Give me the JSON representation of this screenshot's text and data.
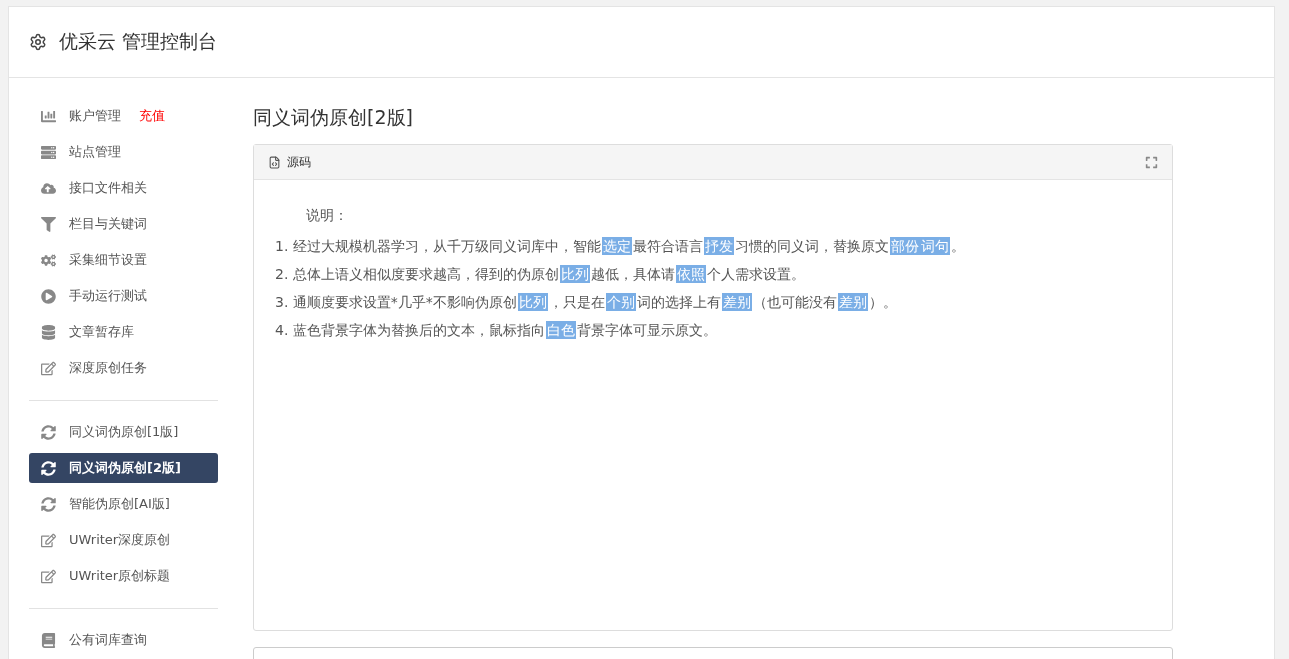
{
  "header": {
    "title": "优采云 管理控制台"
  },
  "sidebar": {
    "groups": [
      {
        "items": [
          {
            "label": "账户管理",
            "badge": "充值",
            "selected": false
          },
          {
            "label": "站点管理",
            "selected": false
          },
          {
            "label": "接口文件相关",
            "selected": false
          },
          {
            "label": "栏目与关键词",
            "selected": false
          },
          {
            "label": "采集细节设置",
            "selected": false
          },
          {
            "label": "手动运行测试",
            "selected": false
          },
          {
            "label": "文章暂存库",
            "selected": false
          },
          {
            "label": "深度原创任务",
            "selected": false
          }
        ]
      },
      {
        "items": [
          {
            "label": "同义词伪原创[1版]",
            "selected": false
          },
          {
            "label": "同义词伪原创[2版]",
            "selected": true
          },
          {
            "label": "智能伪原创[AI版]",
            "selected": false
          },
          {
            "label": "UWriter深度原创",
            "selected": false
          },
          {
            "label": "UWriter原创标题",
            "selected": false
          }
        ]
      },
      {
        "items": [
          {
            "label": "公有词库查询",
            "selected": false
          }
        ]
      }
    ]
  },
  "page_title": "同义词伪原创[2版]",
  "panel": {
    "tab": "源码",
    "heading": "说明：",
    "lines": [
      [
        {
          "text": "1. 经过大规模机器学习，从千万级同义词库中，智能",
          "highlight": false
        },
        {
          "text": "选定",
          "highlight": true
        },
        {
          "text": "最符合语言",
          "highlight": false
        },
        {
          "text": "抒发",
          "highlight": true
        },
        {
          "text": "习惯的同义词，替换原文",
          "highlight": false
        },
        {
          "text": "部份",
          "highlight": true
        },
        {
          "text": "词句",
          "highlight": true
        },
        {
          "text": "。",
          "highlight": false
        }
      ],
      [
        {
          "text": "2. 总体上语义相似度要求越高，得到的伪原创",
          "highlight": false
        },
        {
          "text": "比列",
          "highlight": true
        },
        {
          "text": "越低，具体请",
          "highlight": false
        },
        {
          "text": "依照",
          "highlight": true
        },
        {
          "text": "个人需求设置。",
          "highlight": false
        }
      ],
      [
        {
          "text": "3. 通顺度要求设置*几乎*不影响伪原创",
          "highlight": false
        },
        {
          "text": "比列",
          "highlight": true
        },
        {
          "text": "，只是在",
          "highlight": false
        },
        {
          "text": "个别",
          "highlight": true
        },
        {
          "text": "词的选择上有",
          "highlight": false
        },
        {
          "text": "差别",
          "highlight": true
        },
        {
          "text": "（也可能没有",
          "highlight": false
        },
        {
          "text": "差别",
          "highlight": true
        },
        {
          "text": "）。",
          "highlight": false
        }
      ],
      [
        {
          "text": "4. 蓝色背景字体为替换后的文本，鼠标指向",
          "highlight": false
        },
        {
          "text": "白色",
          "highlight": true
        },
        {
          "text": "背景字体可显示原文。",
          "highlight": false
        }
      ]
    ]
  }
}
